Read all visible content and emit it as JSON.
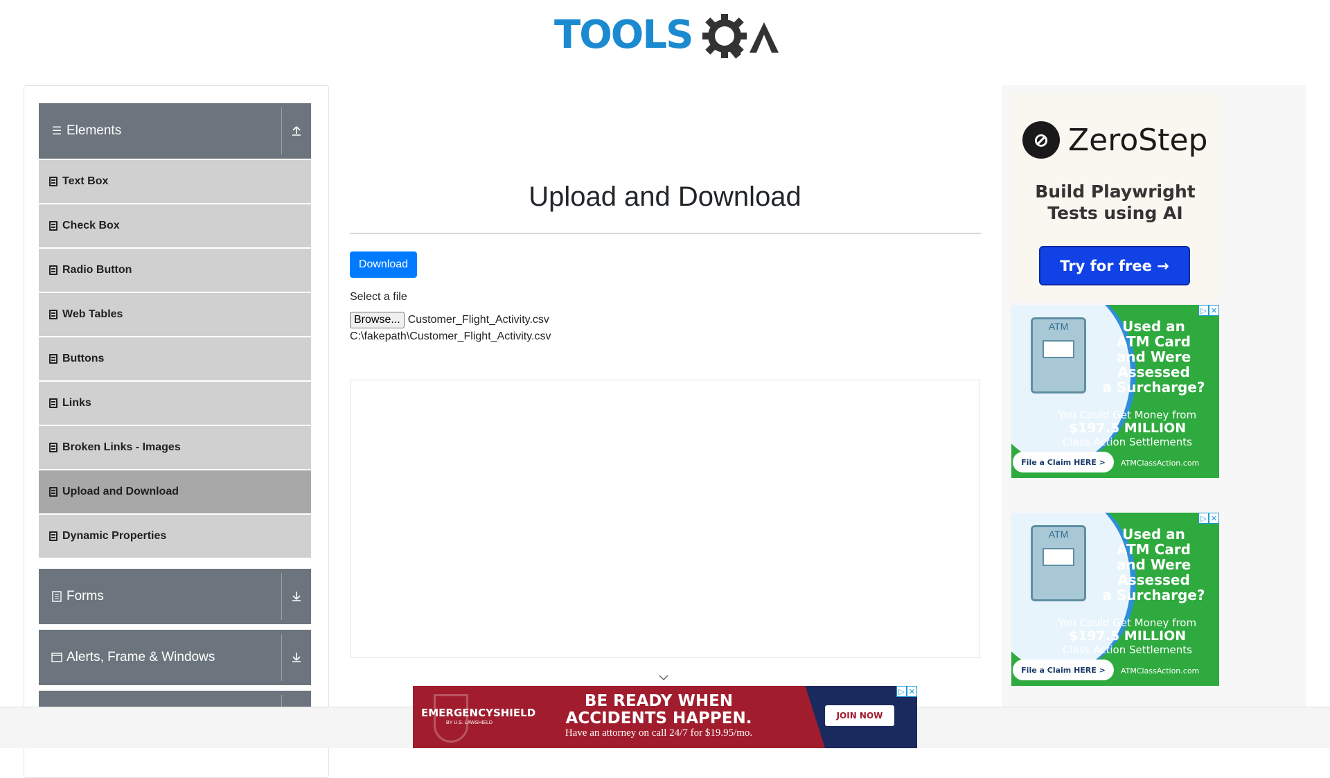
{
  "header": {
    "logo_tools": "TOOLS",
    "logo_qa": "QA"
  },
  "sidebar": {
    "groups": [
      {
        "label": "Elements",
        "icon": "menu-icon",
        "state": "expanded"
      },
      {
        "label": "Forms",
        "icon": "form-icon",
        "state": "collapsed"
      },
      {
        "label": "Alerts, Frame & Windows",
        "icon": "window-icon",
        "state": "collapsed"
      }
    ],
    "items": [
      {
        "label": "Text Box"
      },
      {
        "label": "Check Box"
      },
      {
        "label": "Radio Button"
      },
      {
        "label": "Web Tables"
      },
      {
        "label": "Buttons"
      },
      {
        "label": "Links"
      },
      {
        "label": "Broken Links - Images"
      },
      {
        "label": "Upload and Download",
        "active": true
      },
      {
        "label": "Dynamic Properties"
      }
    ]
  },
  "main": {
    "title": "Upload and Download",
    "download_label": "Download",
    "select_label": "Select a file",
    "browse_label": "Browse...",
    "file_name": "Customer_Flight_Activity.csv",
    "file_path": "C:\\fakepath\\Customer_Flight_Activity.csv"
  },
  "ads": {
    "zerostep": {
      "name": "ZeroStep",
      "tagline_1": "Build Playwright",
      "tagline_2": "Tests using AI",
      "cta": "Try for free →"
    },
    "atm": {
      "machine_label": "ATM",
      "headline_1": "Used an",
      "headline_2": "ATM Card",
      "headline_3": "and Were",
      "headline_4": "Assessed",
      "headline_5": "a Surcharge?",
      "sub_1": "You Could Get Money from",
      "sub_2": "$197.5 MILLION",
      "sub_3": "Class Action Settlements",
      "claim": "File a Claim HERE >",
      "site": "ATMClassAction.com"
    },
    "banner": {
      "brand": "EMERGENCYSHIELD",
      "brand_sub": "BY U.S. LAWSHIELD",
      "headline_1": "BE READY WHEN",
      "headline_2": "ACCIDENTS HAPPEN.",
      "subline": "Have an attorney on call 24/7 for $19.95/mo.",
      "join": "JOIN NOW"
    }
  },
  "colors": {
    "primary": "#007bff",
    "sidebar_header": "#6c757d",
    "menu_item": "#d0d0d0",
    "menu_item_active": "#a8a8a8"
  }
}
